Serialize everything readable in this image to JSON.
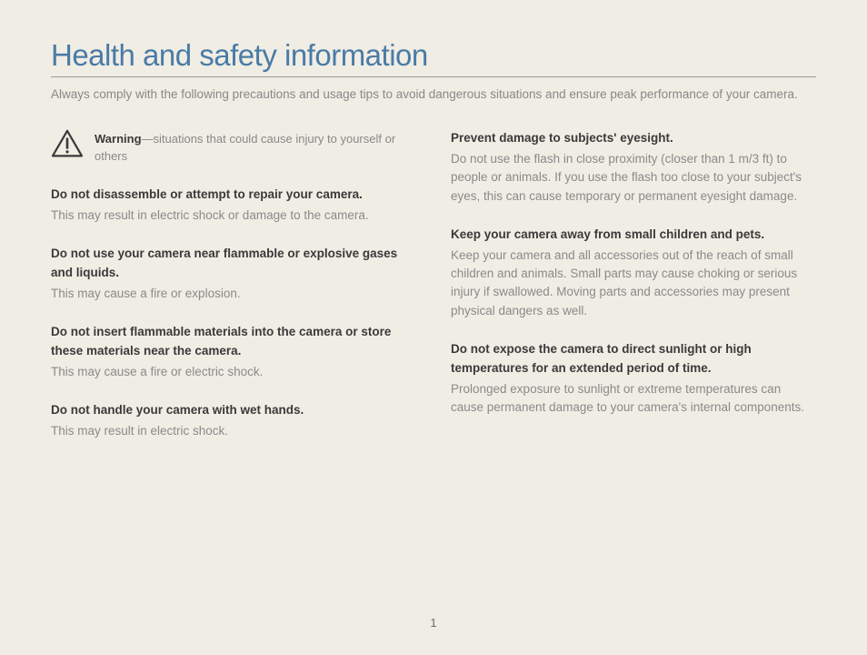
{
  "title": "Health and safety information",
  "subtitle": "Always comply with the following precautions and usage tips to avoid dangerous situations and ensure peak performance of your camera.",
  "warning": {
    "label": "Warning",
    "desc": "—situations that could cause injury to yourself or others"
  },
  "left": [
    {
      "head": "Do not disassemble or attempt to repair your camera.",
      "body": "This may result in electric shock or damage to the camera."
    },
    {
      "head": "Do not use your camera near flammable or explosive gases and liquids.",
      "body": "This may cause a fire or explosion."
    },
    {
      "head": "Do not insert flammable materials into the camera or store these materials near the camera.",
      "body": "This may cause a fire or electric shock."
    },
    {
      "head": "Do not handle your camera with wet hands.",
      "body": "This may result in electric shock."
    }
  ],
  "right": [
    {
      "head": "Prevent damage to subjects' eyesight.",
      "body": "Do not use the flash in close proximity (closer than 1 m/3 ft) to people or animals. If you use the flash too close to your subject's eyes, this can cause temporary or permanent eyesight damage."
    },
    {
      "head": "Keep your camera away from small children and pets.",
      "body": "Keep your camera and all accessories out of the reach of small children and animals. Small parts may cause choking or serious injury if swallowed. Moving parts and accessories may present physical dangers as well."
    },
    {
      "head": "Do not expose the camera to direct sunlight or high temperatures for an extended period of time.",
      "body": "Prolonged exposure to sunlight or extreme temperatures can cause permanent damage to your camera's internal components."
    }
  ],
  "page_number": "1"
}
